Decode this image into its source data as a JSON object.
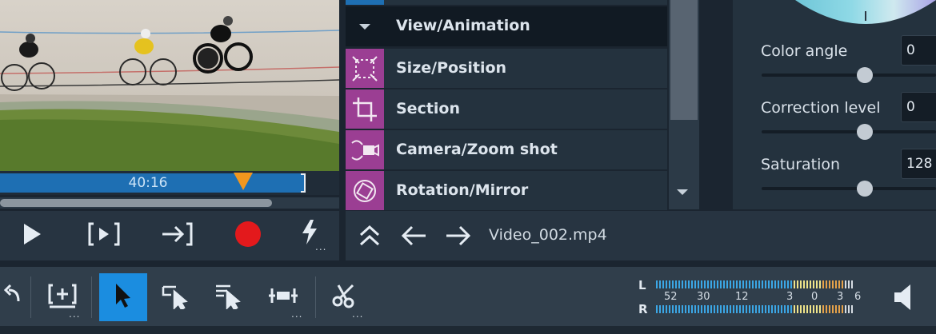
{
  "preview": {
    "timecode": "40:16",
    "playhead_fraction": 0.72,
    "scroll_fraction": 0.8
  },
  "transport": {
    "buttons": [
      "play-icon",
      "play-to-marker-icon",
      "jump-to-end-icon",
      "record-icon",
      "quick-action-icon"
    ],
    "record_color": "#e3191c"
  },
  "effects": {
    "header": "View/Animation",
    "items": [
      {
        "label": "Size/Position",
        "icon": "size-position-icon"
      },
      {
        "label": "Section",
        "icon": "crop-icon"
      },
      {
        "label": "Camera/Zoom shot",
        "icon": "camera-zoom-icon"
      },
      {
        "label": "Rotation/Mirror",
        "icon": "rotation-mirror-icon"
      }
    ],
    "accent": "#9b3e93"
  },
  "navbar": {
    "filename": "Video_002.mp4"
  },
  "color_panel": {
    "controls": [
      {
        "label": "Color angle",
        "value": "0",
        "slider_fraction": 0.6
      },
      {
        "label": "Correction level",
        "value": "0",
        "slider_fraction": 0.6
      },
      {
        "label": "Saturation",
        "value": "128",
        "slider_fraction": 0.6
      }
    ]
  },
  "toolbar": {
    "tools": [
      "undo-icon",
      "insert-icon",
      "mouse-pointer-icon",
      "range-select-icon",
      "multi-select-icon",
      "stretch-icon",
      "cut-icon"
    ],
    "active_tool": "mouse-pointer-icon",
    "active_color": "#1b8de0",
    "more_dots": "..."
  },
  "meter": {
    "left_label": "L",
    "right_label": "R",
    "scale": [
      "52",
      "30",
      "12",
      "3",
      "0",
      "3",
      "6"
    ]
  }
}
